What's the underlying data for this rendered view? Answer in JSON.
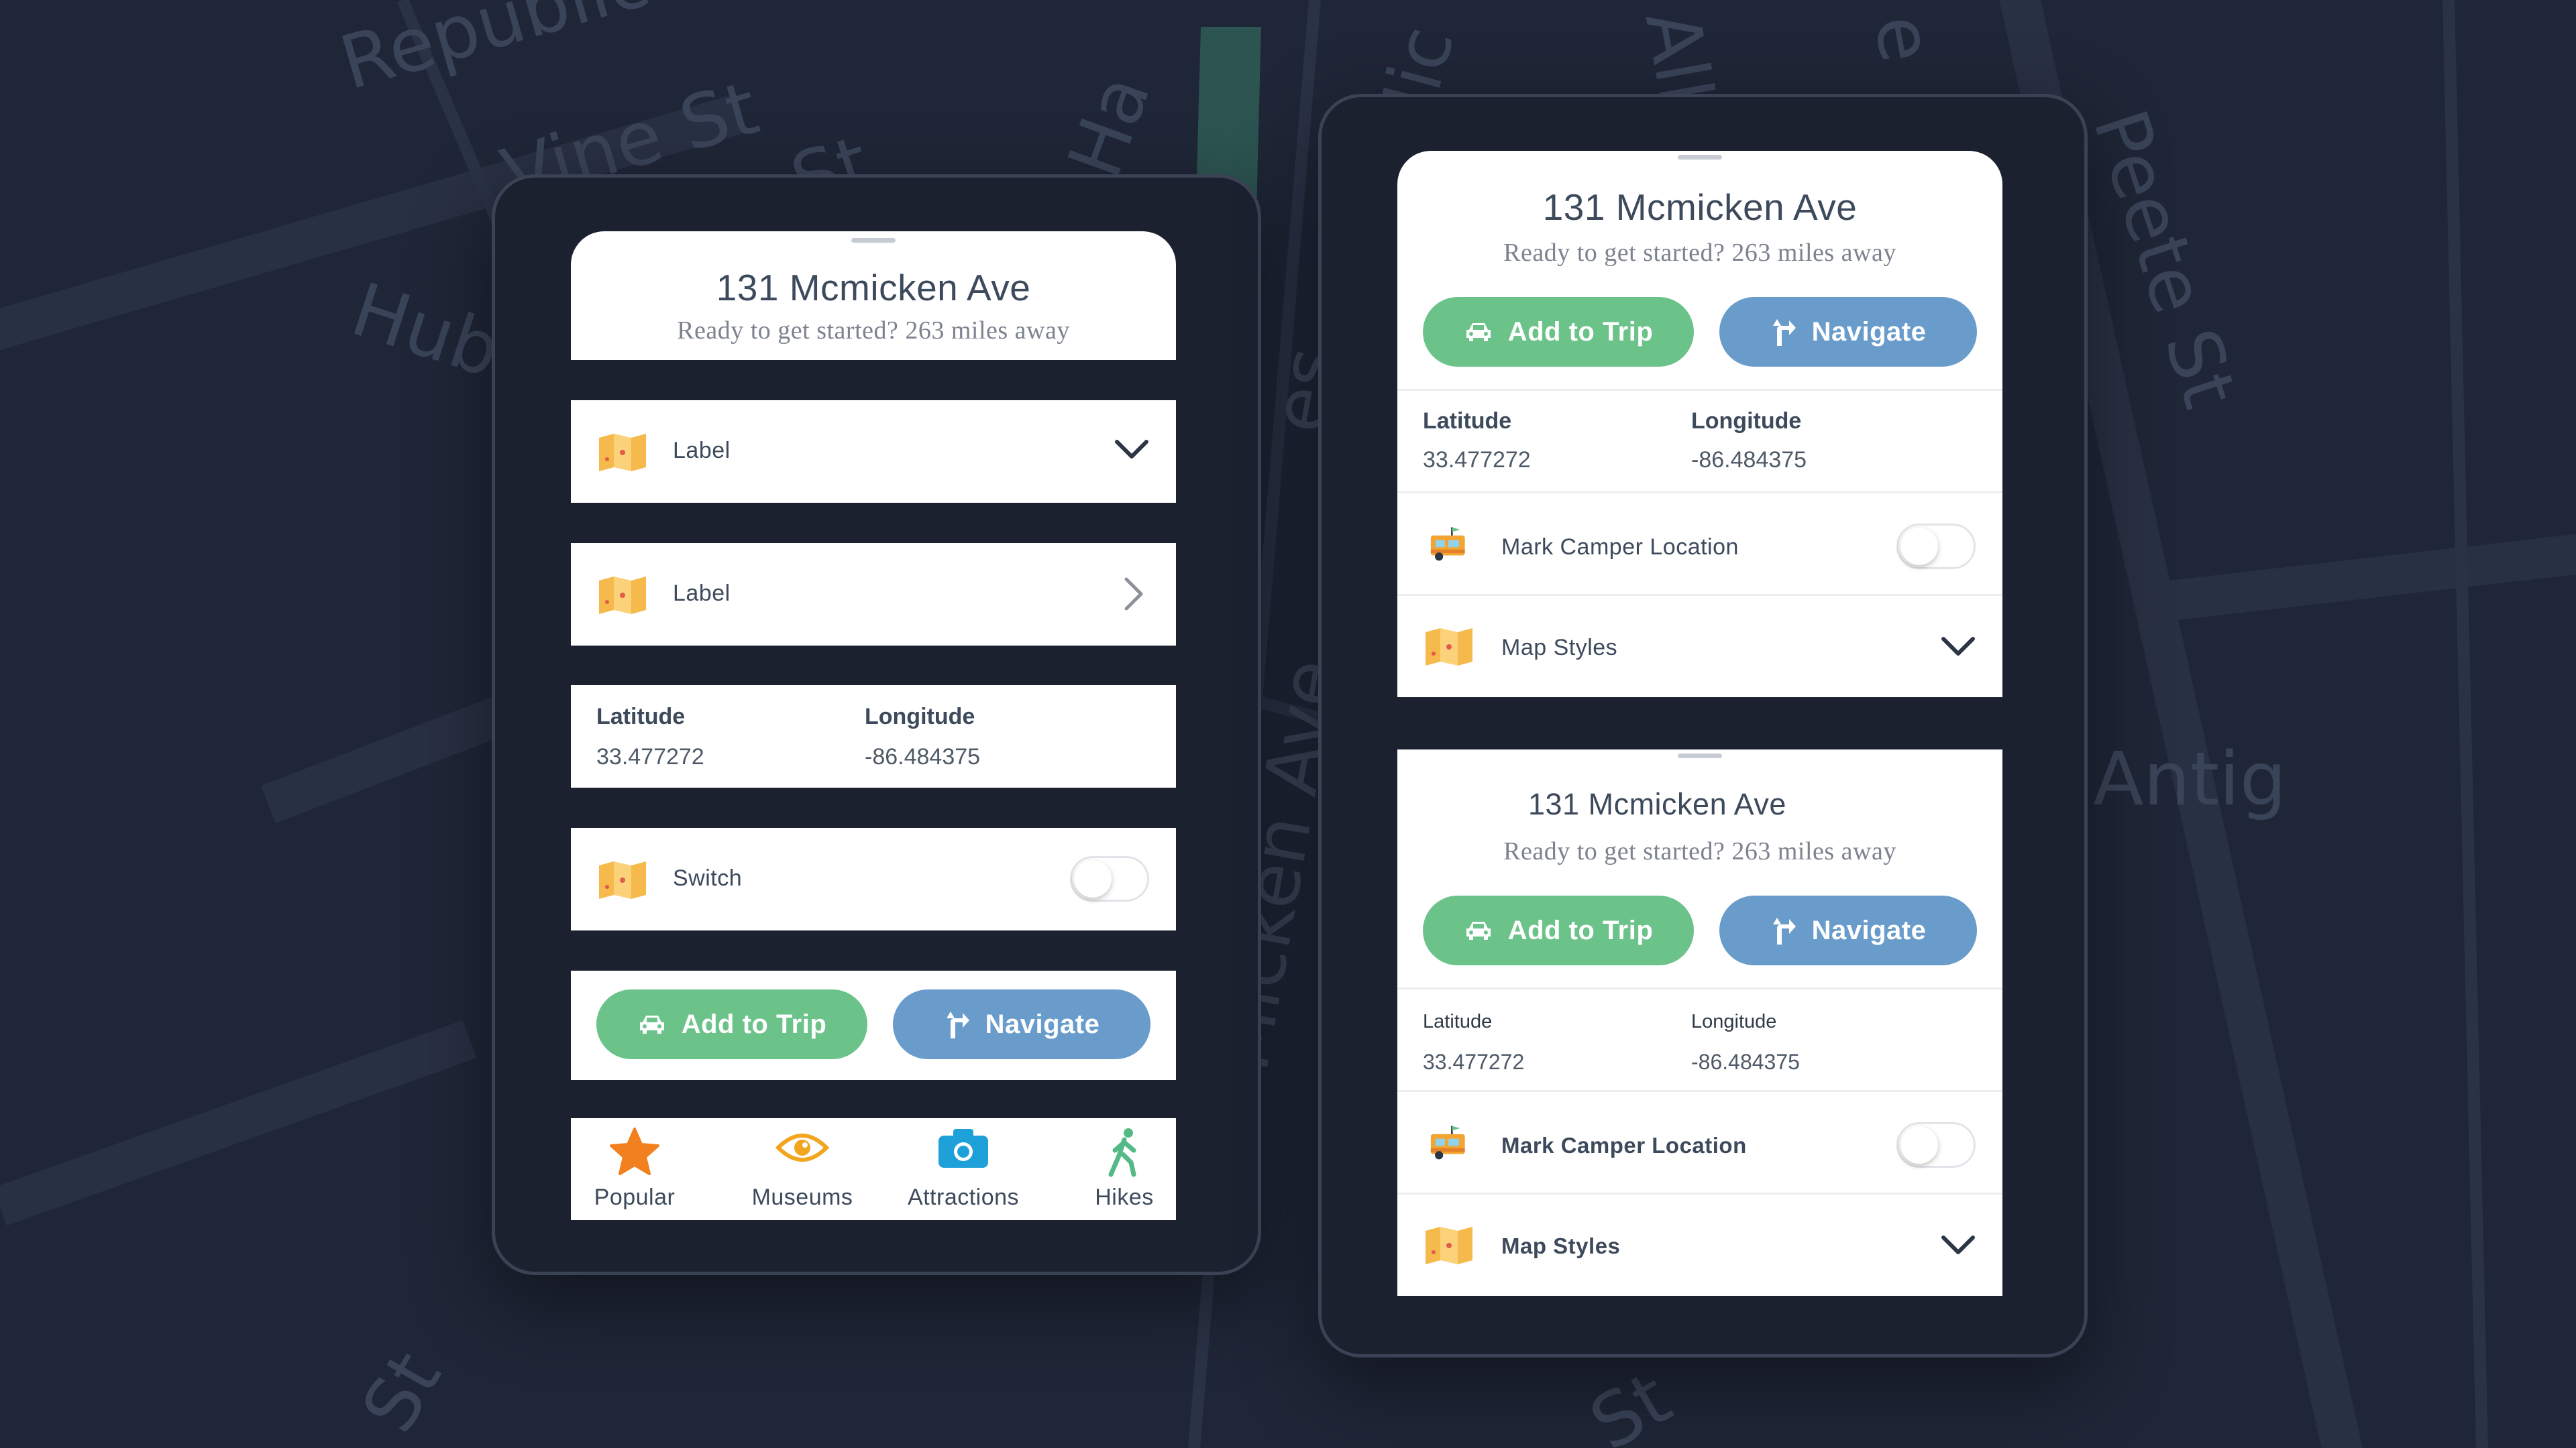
{
  "map": {
    "streets": [
      "Republic",
      "Vine St",
      "St",
      "Ha",
      "Mic",
      "Alle",
      "e",
      "Peete St",
      "Huber St",
      "es",
      "Antig",
      "Micken Ave",
      "St",
      "St"
    ]
  },
  "left_panel": {
    "header": {
      "title": "131 Mcmicken Ave",
      "subtitle": "Ready to get started? 263 miles away"
    },
    "rows": [
      {
        "label": "Label",
        "icon": "map-icon",
        "control": "chevron-down-icon"
      },
      {
        "label": "Label",
        "icon": "map-icon",
        "control": "chevron-right-icon"
      }
    ],
    "coordinates": {
      "lat_label": "Latitude",
      "lat_value": "33.477272",
      "lon_label": "Longitude",
      "lon_value": "-86.484375"
    },
    "switch_row": {
      "label": "Switch",
      "icon": "map-icon",
      "on": false
    },
    "buttons": {
      "add": "Add to Trip",
      "navigate": "Navigate"
    },
    "tabs": [
      {
        "label": "Popular",
        "icon": "star-icon"
      },
      {
        "label": "Museums",
        "icon": "eye-icon"
      },
      {
        "label": "Attractions",
        "icon": "camera-icon"
      },
      {
        "label": "Hikes",
        "icon": "hiker-icon"
      }
    ]
  },
  "right_panels": [
    {
      "title": "131 Mcmicken Ave",
      "subtitle": "Ready to get started? 263 miles away",
      "buttons": {
        "add": "Add to Trip",
        "navigate": "Navigate"
      },
      "coordinates": {
        "lat_label": "Latitude",
        "lat_value": "33.477272",
        "lon_label": "Longitude",
        "lon_value": "-86.484375"
      },
      "camper": {
        "label": "Mark Camper Location",
        "icon": "camper-icon",
        "on": false
      },
      "map_styles": {
        "label": "Map Styles",
        "icon": "map-icon"
      }
    },
    {
      "title": "131 Mcmicken Ave",
      "subtitle": "Ready to get started? 263 miles away",
      "buttons": {
        "add": "Add to Trip",
        "navigate": "Navigate"
      },
      "coordinates": {
        "lat_label": "Latitude",
        "lat_value": "33.477272",
        "lon_label": "Longitude",
        "lon_value": "-86.484375"
      },
      "camper": {
        "label": "Mark Camper Location",
        "icon": "camper-icon",
        "on": false
      },
      "map_styles": {
        "label": "Map Styles",
        "icon": "map-icon"
      }
    }
  ],
  "colors": {
    "background": "#1f2637",
    "green": "#6cc38a",
    "blue": "#6a9ccb",
    "text": "#3d4a5c",
    "park": "#2c5451",
    "map_icon": "#f7c35a"
  }
}
